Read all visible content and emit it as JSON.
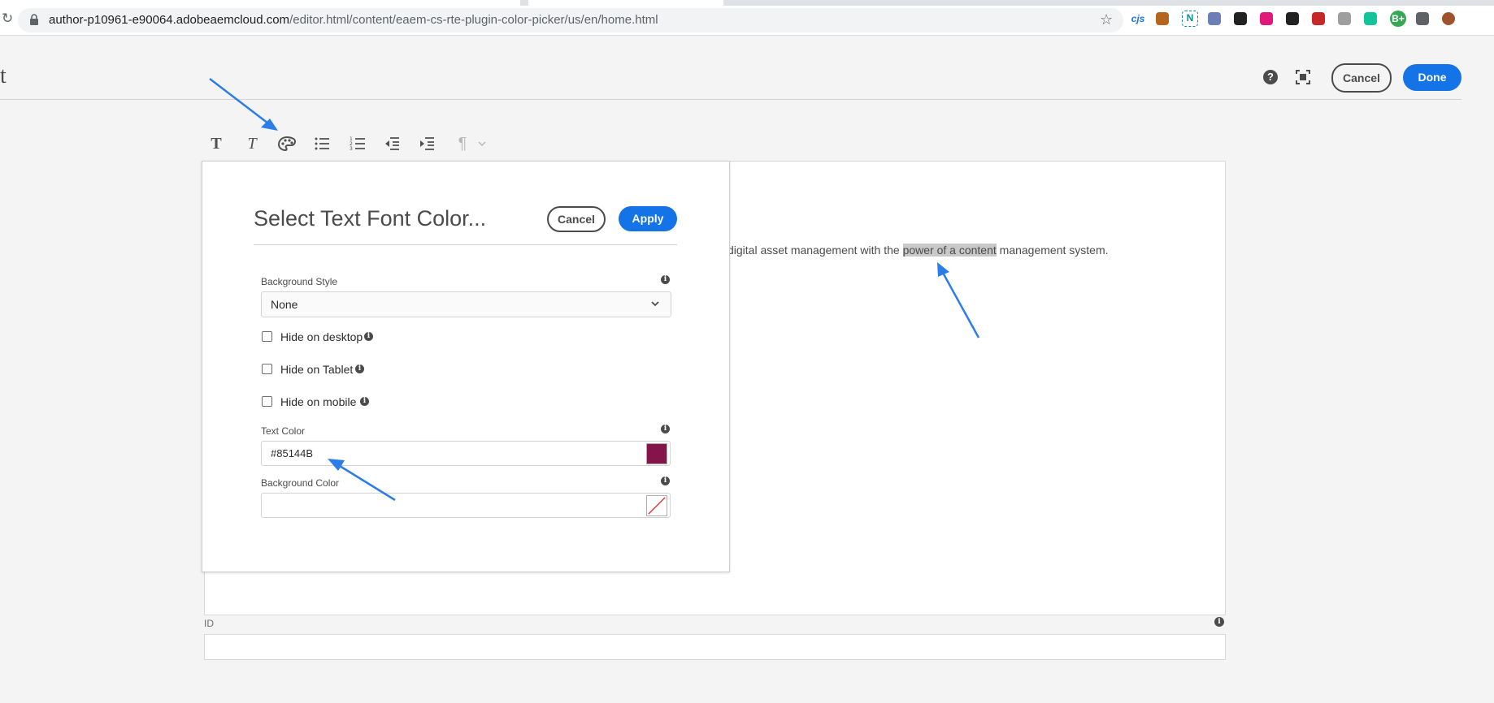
{
  "browser": {
    "url_host": "author-p10961-e90064.adobeaemcloud.com",
    "url_path": "/editor.html/content/eaem-cs-rte-plugin-color-picker/us/en/home.html",
    "extensions": [
      {
        "name": "cjs-extension-icon",
        "label": "cjs",
        "color": "#1a73e8"
      },
      {
        "name": "pen-extension-icon",
        "label": "",
        "color": "#b5651d"
      },
      {
        "name": "n-extension-icon",
        "label": "N",
        "color": "#0a8f8f"
      },
      {
        "name": "script-extension-icon",
        "label": "",
        "color": "#6a7fb5"
      },
      {
        "name": "spy-extension-icon",
        "label": "",
        "color": "#222222"
      },
      {
        "name": "ring-extension-icon",
        "label": "",
        "color": "#e0187a"
      },
      {
        "name": "triangle-extension-icon",
        "label": "",
        "color": "#222222"
      },
      {
        "name": "red-extension-icon",
        "label": "",
        "color": "#c62828"
      },
      {
        "name": "feather-extension-icon",
        "label": "",
        "color": "#9e9e9e"
      },
      {
        "name": "grammarly-extension-icon",
        "label": "",
        "color": "#15c39a"
      },
      {
        "name": "b-extension-icon",
        "label": "B+",
        "color": "#34a853"
      },
      {
        "name": "puzzle-extension-icon",
        "label": "",
        "color": "#5f6368"
      },
      {
        "name": "profile-avatar-icon",
        "label": "",
        "color": "#a0522d"
      }
    ]
  },
  "header": {
    "title_fragment": "t",
    "cancel_label": "Cancel",
    "done_label": "Done"
  },
  "editor": {
    "text_before": "digital asset management with the ",
    "text_selected": "power of a content",
    "text_after": " management system."
  },
  "dialog": {
    "title": "Select Text Font Color...",
    "cancel_label": "Cancel",
    "apply_label": "Apply",
    "background_style": {
      "label": "Background Style",
      "value": "None"
    },
    "checkboxes": [
      {
        "label": "Hide on desktop",
        "checked": false
      },
      {
        "label": "Hide on Tablet",
        "checked": false
      },
      {
        "label": "Hide on mobile",
        "checked": false
      }
    ],
    "text_color": {
      "label": "Text Color",
      "value": "#85144B",
      "swatch": "#85144b"
    },
    "background_color": {
      "label": "Background Color",
      "value": ""
    }
  },
  "id_field": {
    "label": "ID",
    "value": ""
  },
  "colors": {
    "accent": "#1473e6",
    "annotation_arrow": "#2b7de9"
  }
}
